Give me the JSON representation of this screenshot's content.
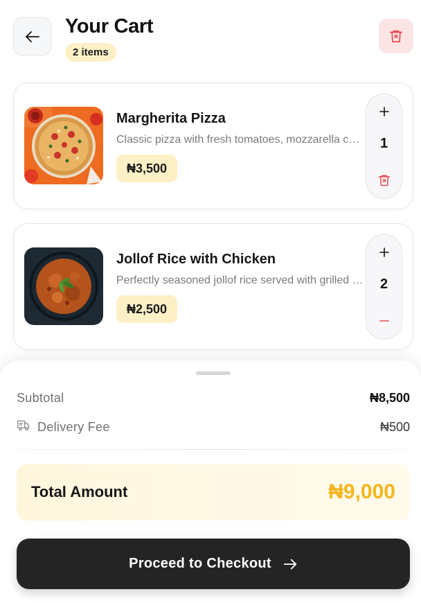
{
  "header": {
    "title": "Your Cart",
    "item_count": "2 items",
    "back_icon": "arrow-left-icon",
    "clear_icon": "trash-icon"
  },
  "items": [
    {
      "name": "Margherita Pizza",
      "description": "Classic pizza with fresh tomatoes, mozzarella cheese and basil",
      "price": "₦3,500",
      "quantity": "1",
      "image": "pizza-image",
      "decrement_icon": "trash-icon"
    },
    {
      "name": "Jollof Rice with Chicken",
      "description": "Perfectly seasoned jollof rice served with grilled chicken",
      "price": "₦2,500",
      "quantity": "2",
      "image": "jollof-rice-image",
      "decrement_icon": "minus-icon"
    }
  ],
  "summary": {
    "subtotal_label": "Subtotal",
    "subtotal_value": "₦8,500",
    "delivery_label": "Delivery Fee",
    "delivery_value": "₦500",
    "delivery_icon": "truck-icon",
    "total_label": "Total Amount",
    "total_value": "₦9,000"
  },
  "checkout": {
    "label": "Proceed to Checkout",
    "icon": "arrow-right-icon"
  },
  "colors": {
    "accent": "#f3b61f",
    "badge_bg": "#fdf0c6",
    "danger": "#e5484d",
    "button_dark": "#242424"
  }
}
